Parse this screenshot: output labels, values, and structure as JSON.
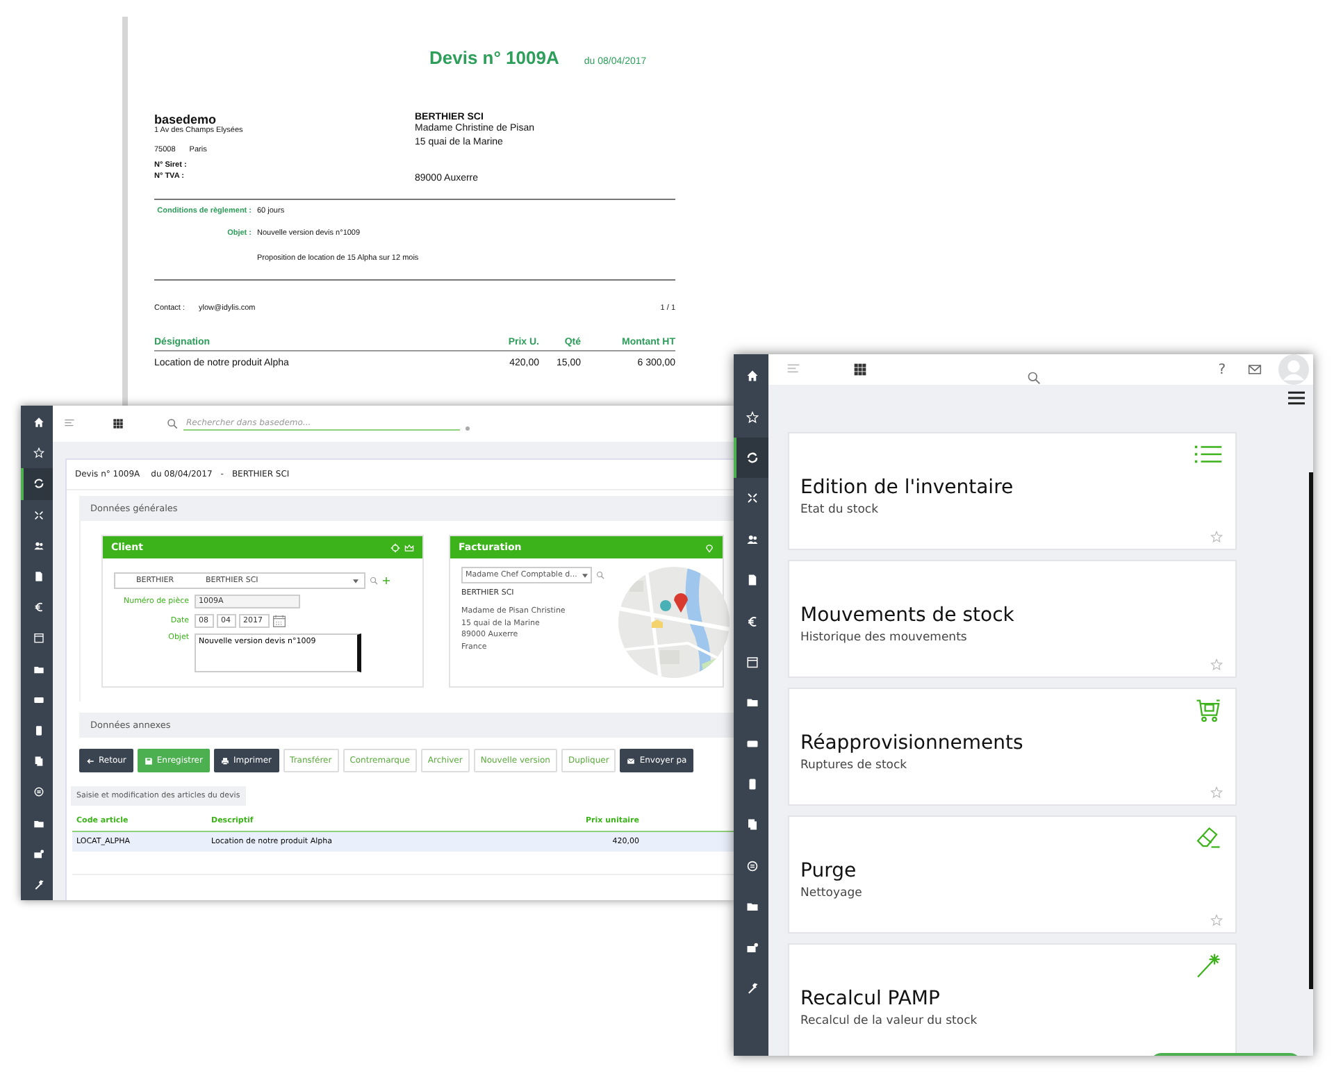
{
  "quote_document": {
    "title": "Devis n° 1009A",
    "date": "du 08/04/2017",
    "sender": {
      "name": "basedemo",
      "address": "1 Av des Champs Elysées",
      "postcode": "75008",
      "city": "Paris",
      "ids": [
        "N° Siret :",
        "N° TVA :"
      ]
    },
    "recipient": {
      "name": "BERTHIER SCI",
      "lines": [
        "Madame Christine de Pisan",
        "15 quai de la Marine"
      ],
      "city_line": "89000 Auxerre"
    },
    "terms": [
      {
        "label": "Conditions de règlement :",
        "value": "60 jours"
      },
      {
        "label": "Objet :",
        "value": "Nouvelle version devis n°1009"
      }
    ],
    "description": "Proposition de location de 15 Alpha sur 12 mois",
    "contact_label": "Contact :",
    "contact": "ylow@idylis.com",
    "page": "1 / 1",
    "table": {
      "columns": [
        "Désignation",
        "Prix U.",
        "Qté",
        "Montant HT"
      ],
      "rows": [
        [
          "Location de notre produit Alpha",
          "420,00",
          "15,00",
          "6 300,00"
        ]
      ]
    }
  },
  "quote_editor": {
    "sidebar": [
      {
        "selected": false
      },
      {
        "selected": false
      },
      {
        "selected": true
      },
      {
        "selected": false
      },
      {
        "selected": false
      },
      {
        "selected": false
      },
      {
        "selected": false
      },
      {
        "selected": false
      },
      {
        "selected": false
      },
      {
        "selected": false
      },
      {
        "selected": false
      },
      {
        "selected": false
      },
      {
        "selected": false
      },
      {
        "selected": false
      },
      {
        "selected": false
      },
      {
        "selected": false
      }
    ],
    "search": {
      "placeholder": "Rechercher dans basedemo..."
    },
    "breadcrumb": {
      "title": "Devis n° 1009A",
      "date": "du 08/04/2017",
      "separator": "-",
      "client": "BERTHIER SCI"
    },
    "general_section": "Données générales",
    "client_panel": {
      "title": "Client",
      "client_code": "BERTHIER",
      "client_name": "BERTHIER SCI",
      "piece_label": "Numéro de pièce",
      "piece_value": "1009A",
      "date_label": "Date",
      "date_parts": [
        "08",
        "04",
        "2017"
      ],
      "object_label": "Objet",
      "object_value": "Nouvelle version devis n°1009"
    },
    "billing_panel": {
      "title": "Facturation",
      "contact": "Madame Chef Comptable d...",
      "company": "BERTHIER SCI",
      "address": [
        "Madame de Pisan Christine",
        "15 quai de la Marine",
        "89000 Auxerre",
        "France"
      ],
      "map": {
        "kind": "picture"
      }
    },
    "annex_section": "Données annexes",
    "actions": [
      {
        "label": "Retour",
        "kind": "dark"
      },
      {
        "label": "Enregistrer",
        "kind": "primary"
      },
      {
        "label": "Imprimer",
        "kind": "dark"
      },
      {
        "label": "Transférer",
        "kind": "outline"
      },
      {
        "label": "Contremarque",
        "kind": "outline"
      },
      {
        "label": "Archiver",
        "kind": "outline"
      },
      {
        "label": "Nouvelle version",
        "kind": "outline"
      },
      {
        "label": "Dupliquer",
        "kind": "outline"
      },
      {
        "label": "Envoyer pa",
        "kind": "dark"
      }
    ],
    "items_tab": "Saisie et modification des articles du devis",
    "items_table": {
      "columns": [
        "Code article",
        "Descriptif",
        "Prix unitaire"
      ],
      "rows": [
        {
          "cells": [
            "LOCAT_ALPHA",
            "Location de notre produit Alpha",
            "420,00"
          ],
          "selected": true
        }
      ]
    }
  },
  "stock_menu": {
    "sidebar": [
      {
        "selected": false
      },
      {
        "selected": false
      },
      {
        "selected": true
      },
      {
        "selected": false
      },
      {
        "selected": false
      },
      {
        "selected": false
      },
      {
        "selected": false
      },
      {
        "selected": false
      },
      {
        "selected": false
      },
      {
        "selected": false
      },
      {
        "selected": false
      },
      {
        "selected": false
      },
      {
        "selected": false
      },
      {
        "selected": false
      },
      {
        "selected": false
      },
      {
        "selected": false
      }
    ],
    "help": "?",
    "cards": [
      {
        "title": "Edition de l'inventaire",
        "subtitle": "Etat du stock",
        "favorite": false
      },
      {
        "title": "Mouvements de stock",
        "subtitle": "Historique des mouvements",
        "favorite": false
      },
      {
        "title": "Réapprovisionnements",
        "subtitle": "Ruptures de stock",
        "favorite": false
      },
      {
        "title": "Purge",
        "subtitle": "Nettoyage",
        "favorite": false
      },
      {
        "title": "Recalcul PAMP",
        "subtitle": "Recalcul de la valeur du stock"
      }
    ]
  }
}
